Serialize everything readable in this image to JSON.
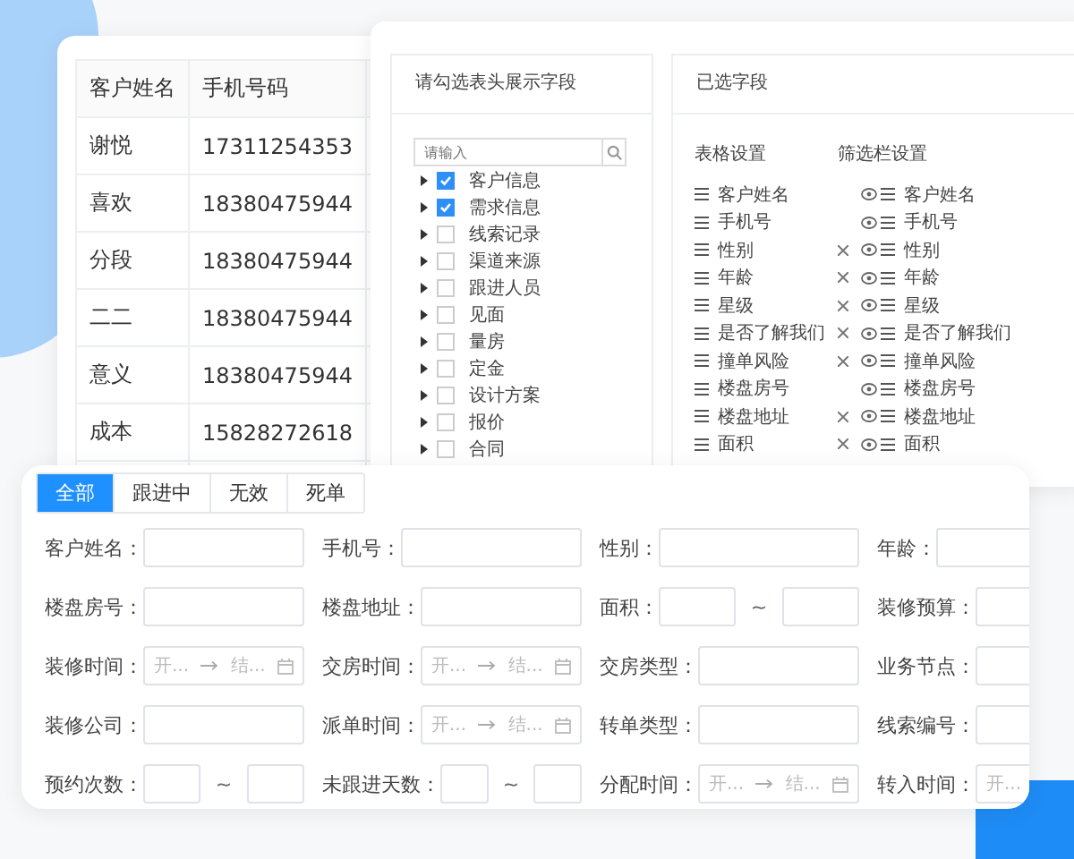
{
  "table": {
    "columns": [
      "客户姓名",
      "手机号码"
    ],
    "rows": [
      [
        "谢悦",
        "17311254353"
      ],
      [
        "喜欢",
        "18380475944"
      ],
      [
        "分段",
        "18380475944"
      ],
      [
        "二二",
        "18380475944"
      ],
      [
        "意义",
        "18380475944"
      ],
      [
        "成本",
        "15828272618"
      ]
    ]
  },
  "field_picker": {
    "title": "请勾选表头展示字段",
    "search": {
      "placeholder": "请输入"
    },
    "items": [
      {
        "label": "客户信息",
        "checked": true
      },
      {
        "label": "需求信息",
        "checked": true
      },
      {
        "label": "线索记录",
        "checked": false
      },
      {
        "label": "渠道来源",
        "checked": false
      },
      {
        "label": "跟进人员",
        "checked": false
      },
      {
        "label": "见面",
        "checked": false
      },
      {
        "label": "量房",
        "checked": false
      },
      {
        "label": "定金",
        "checked": false
      },
      {
        "label": "设计方案",
        "checked": false
      },
      {
        "label": "报价",
        "checked": false
      },
      {
        "label": "合同",
        "checked": false
      }
    ]
  },
  "selected_fields": {
    "title": "已选字段",
    "table_heading": "表格设置",
    "filter_heading": "筛选栏设置",
    "rows": [
      {
        "table_label": "客户姓名",
        "removable": false,
        "filter_label": "客户姓名"
      },
      {
        "table_label": "手机号",
        "removable": false,
        "filter_label": "手机号"
      },
      {
        "table_label": "性别",
        "removable": true,
        "filter_label": "性别"
      },
      {
        "table_label": "年龄",
        "removable": true,
        "filter_label": "年龄"
      },
      {
        "table_label": "星级",
        "removable": true,
        "filter_label": "星级"
      },
      {
        "table_label": "是否了解我们",
        "removable": true,
        "filter_label": "是否了解我们"
      },
      {
        "table_label": "撞单风险",
        "removable": true,
        "filter_label": "撞单风险"
      },
      {
        "table_label": "楼盘房号",
        "removable": false,
        "filter_label": "楼盘房号"
      },
      {
        "table_label": "楼盘地址",
        "removable": true,
        "filter_label": "楼盘地址"
      },
      {
        "table_label": "面积",
        "removable": true,
        "filter_label": "面积"
      }
    ]
  },
  "filter_form": {
    "tabs": [
      {
        "label": "全部",
        "selected": true
      },
      {
        "label": "跟进中",
        "selected": false
      },
      {
        "label": "无效",
        "selected": false
      },
      {
        "label": "死单",
        "selected": false
      }
    ],
    "fields": [
      {
        "label": "客户姓名：",
        "kind": "input"
      },
      {
        "label": "手机号：",
        "kind": "input"
      },
      {
        "label": "性别：",
        "kind": "input"
      },
      {
        "label": "年龄：",
        "kind": "input"
      },
      {
        "label": "楼盘房号：",
        "kind": "input"
      },
      {
        "label": "楼盘地址：",
        "kind": "input"
      },
      {
        "label": "面积：",
        "kind": "range",
        "separator": "~"
      },
      {
        "label": "装修预算：",
        "kind": "input"
      },
      {
        "label": "装修时间：",
        "kind": "date",
        "start_placeholder": "开...",
        "end_placeholder": "结..."
      },
      {
        "label": "交房时间：",
        "kind": "date",
        "start_placeholder": "开...",
        "end_placeholder": "结..."
      },
      {
        "label": "交房类型：",
        "kind": "input"
      },
      {
        "label": "业务节点：",
        "kind": "input"
      },
      {
        "label": "装修公司：",
        "kind": "input"
      },
      {
        "label": "派单时间：",
        "kind": "date",
        "start_placeholder": "开...",
        "end_placeholder": "结..."
      },
      {
        "label": "转单类型：",
        "kind": "input"
      },
      {
        "label": "线索编号：",
        "kind": "input"
      },
      {
        "label": "预约次数：",
        "kind": "range",
        "separator": "~"
      },
      {
        "label": "未跟进天数：",
        "kind": "range",
        "separator": "~"
      },
      {
        "label": "分配时间：",
        "kind": "date",
        "start_placeholder": "开...",
        "end_placeholder": "结..."
      },
      {
        "label": "转入时间：",
        "kind": "date",
        "start_placeholder": "开..."
      }
    ]
  }
}
